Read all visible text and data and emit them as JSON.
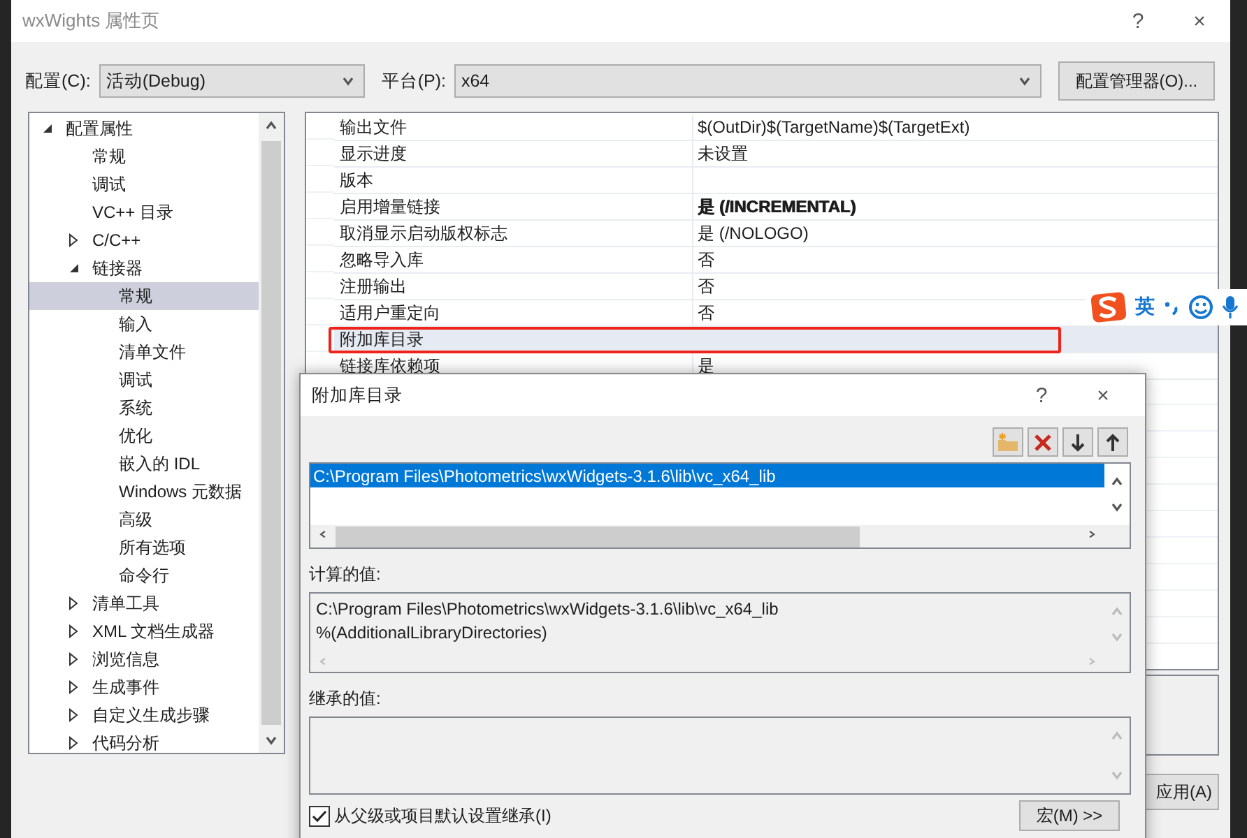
{
  "window": {
    "title": "wxWights 属性页",
    "help": "?",
    "close": "×"
  },
  "config": {
    "label": "配置(C):",
    "value": "活动(Debug)"
  },
  "platform": {
    "label": "平台(P):",
    "value": "x64"
  },
  "config_manager_button": "配置管理器(O)...",
  "tree": [
    {
      "label": "配置属性",
      "expanded": true,
      "selected": false,
      "children": [
        {
          "label": "常规",
          "selected": false
        },
        {
          "label": "调试",
          "selected": false
        },
        {
          "label": "VC++ 目录",
          "selected": false
        },
        {
          "label": "C/C++",
          "expanded": false,
          "selected": false
        },
        {
          "label": "链接器",
          "expanded": true,
          "selected": false,
          "children": [
            {
              "label": "常规",
              "selected": true
            },
            {
              "label": "输入",
              "selected": false
            },
            {
              "label": "清单文件",
              "selected": false
            },
            {
              "label": "调试",
              "selected": false
            },
            {
              "label": "系统",
              "selected": false
            },
            {
              "label": "优化",
              "selected": false
            },
            {
              "label": "嵌入的 IDL",
              "selected": false
            },
            {
              "label": "Windows 元数据",
              "selected": false
            },
            {
              "label": "高级",
              "selected": false
            },
            {
              "label": "所有选项",
              "selected": false
            },
            {
              "label": "命令行",
              "selected": false
            }
          ]
        },
        {
          "label": "清单工具",
          "expanded": false,
          "selected": false
        },
        {
          "label": "XML 文档生成器",
          "expanded": false,
          "selected": false
        },
        {
          "label": "浏览信息",
          "expanded": false,
          "selected": false
        },
        {
          "label": "生成事件",
          "expanded": false,
          "selected": false
        },
        {
          "label": "自定义生成步骤",
          "expanded": false,
          "selected": false
        },
        {
          "label": "代码分析",
          "expanded": false,
          "selected": false
        }
      ]
    }
  ],
  "properties": [
    {
      "name": "输出文件",
      "value": "$(OutDir)$(TargetName)$(TargetExt)",
      "bold": false,
      "selected": false
    },
    {
      "name": "显示进度",
      "value": "未设置",
      "bold": false,
      "selected": false
    },
    {
      "name": "版本",
      "selected": false
    },
    {
      "name": "启用增量链接",
      "value": "是 (/INCREMENTAL)",
      "bold": true,
      "selected": false
    },
    {
      "name": "取消显示启动版权标志",
      "value": "是 (/NOLOGO)",
      "bold": false,
      "selected": false
    },
    {
      "name": "忽略导入库",
      "value": "否",
      "bold": false,
      "selected": false
    },
    {
      "name": "注册输出",
      "value": "否",
      "bold": false,
      "selected": false
    },
    {
      "name": "适用户重定向",
      "value": "否",
      "bold": false,
      "selected": false
    },
    {
      "name": "附加库目录",
      "selected": true
    },
    {
      "name": "链接库依赖项",
      "value": "是",
      "bold": false,
      "selected": false
    }
  ],
  "apply_button": "应用(A)",
  "ime_toolbar": {
    "mode": "英"
  },
  "dialog": {
    "title": "附加库目录",
    "help": "?",
    "close": "×",
    "entries": [
      {
        "text": "C:\\Program Files\\Photometrics\\wxWidgets-3.1.6\\lib\\vc_x64_lib",
        "selected": true
      }
    ],
    "computed_label": "计算的值:",
    "computed_lines": [
      "C:\\Program Files\\Photometrics\\wxWidgets-3.1.6\\lib\\vc_x64_lib",
      "%(AdditionalLibraryDirectories)"
    ],
    "inherited_label": "继承的值:",
    "inherit": {
      "label": "从父级或项目默认设置继承(I)",
      "checked": true
    },
    "macros_button": "宏(M) >>"
  }
}
